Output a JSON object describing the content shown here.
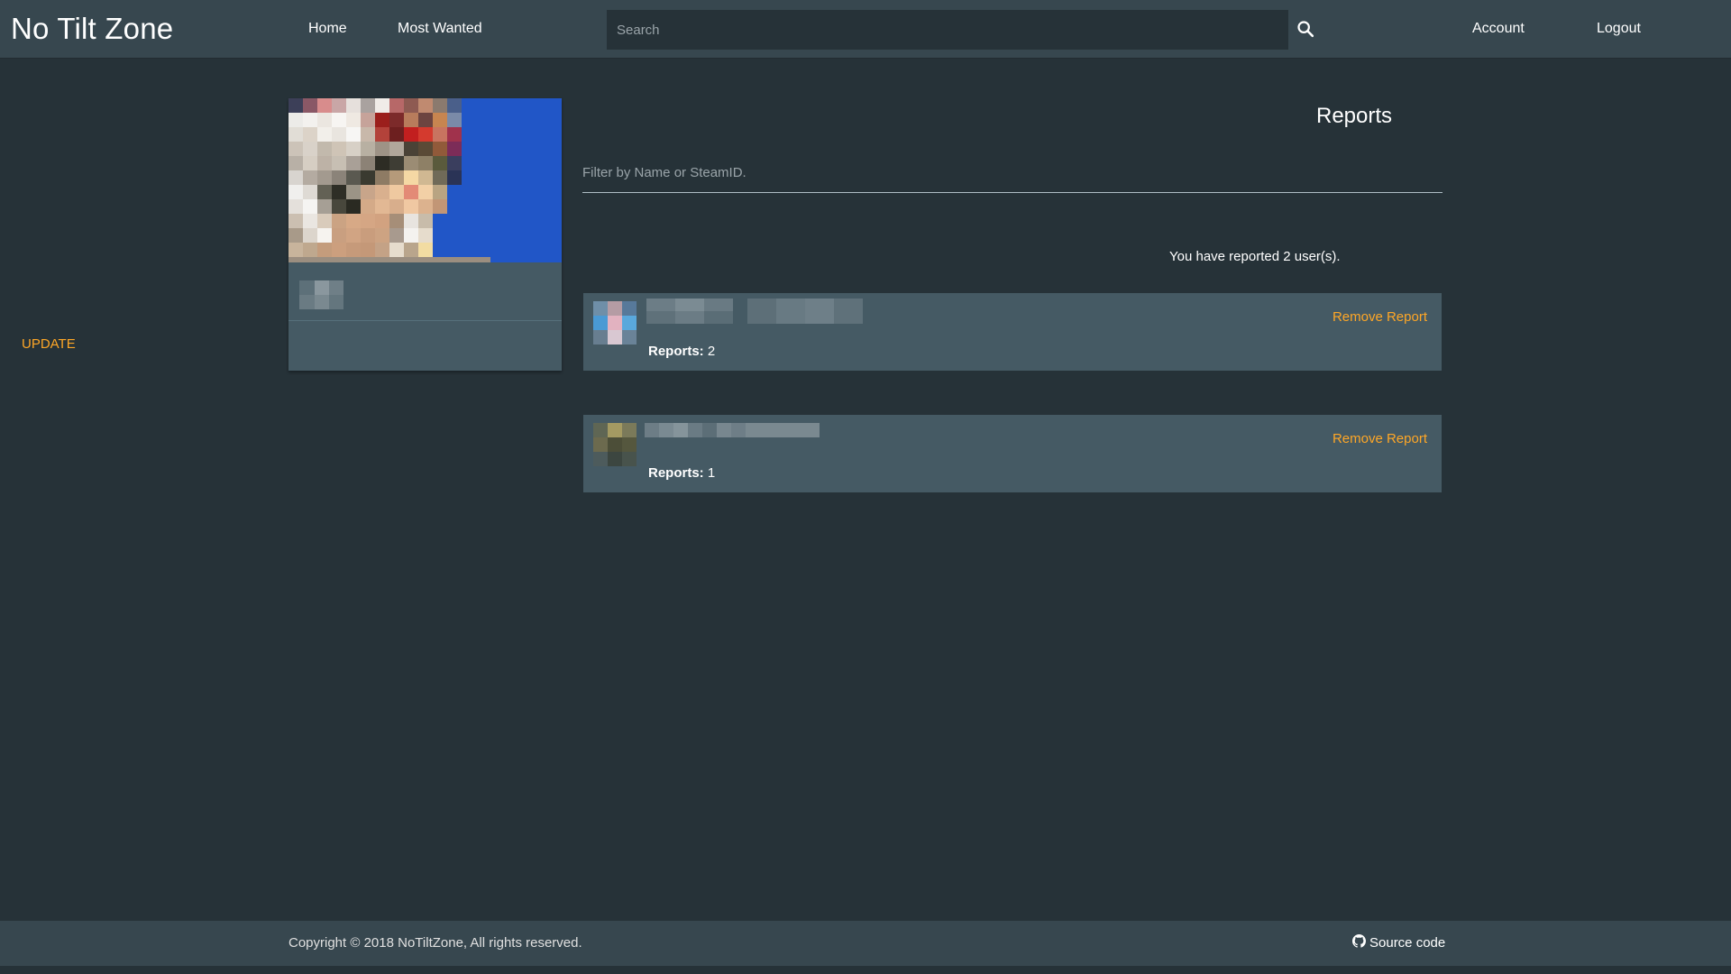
{
  "navbar": {
    "brand": "No Tilt Zone",
    "links": {
      "home": "Home",
      "most_wanted": "Most Wanted",
      "account": "Account",
      "logout": "Logout"
    },
    "search": {
      "placeholder": "Search",
      "icon": "search-icon"
    }
  },
  "profile": {
    "image": "pixelated-profile-image",
    "update_label": "UPDATE"
  },
  "reports": {
    "title": "Reports",
    "filter_placeholder": "Filter by Name or SteamID.",
    "summary": "You have reported 2 user(s).",
    "items": [
      {
        "count_label": "Reports:",
        "count": "2",
        "remove_label": "Remove Report"
      },
      {
        "count_label": "Reports:",
        "count": "1",
        "remove_label": "Remove Report"
      }
    ]
  },
  "footer": {
    "copyright": "Copyright © 2018 NoTiltZone, All rights reserved.",
    "source_label": "Source code",
    "source_icon": "github-icon"
  },
  "colors": {
    "background": "#263238",
    "navbar": "#37474f",
    "card": "#455a64",
    "accent": "#ffa726"
  }
}
